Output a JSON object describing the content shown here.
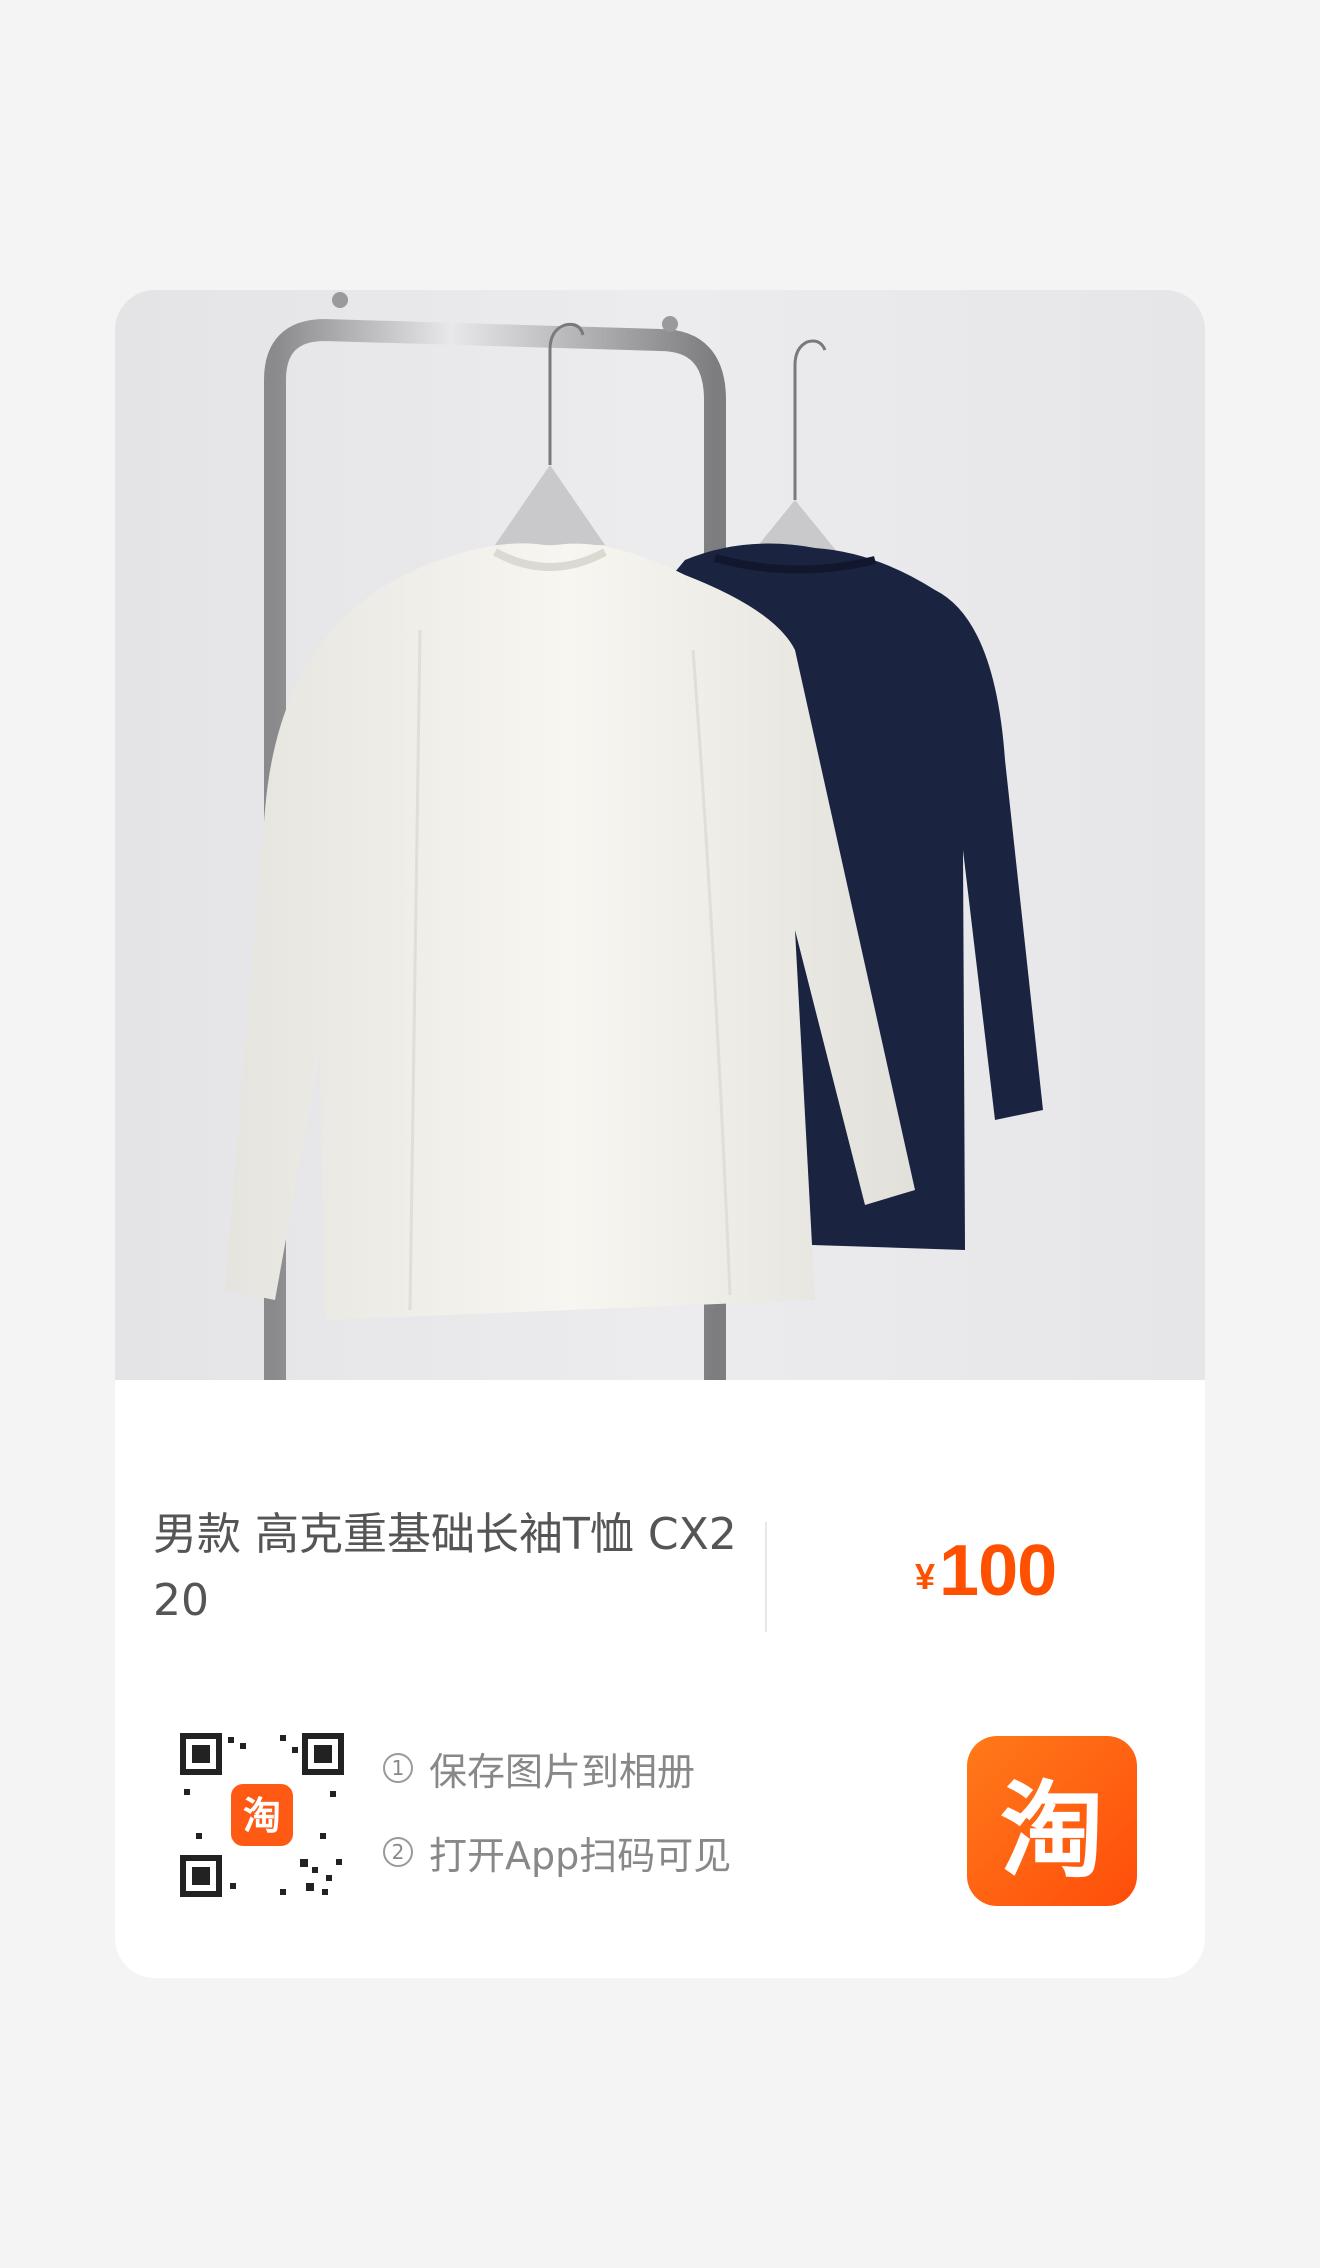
{
  "product": {
    "title": "男款 高克重基础长袖T恤 CX220",
    "price_symbol": "¥",
    "price_value": "100",
    "price_color": "#ff5000"
  },
  "instructions": [
    {
      "number": "1",
      "text": "保存图片到相册"
    },
    {
      "number": "2",
      "text": "打开App扫码可见"
    }
  ],
  "qr_badge": {
    "glyph": "淘"
  },
  "app_logo": {
    "glyph": "淘",
    "color": "#ff5000"
  }
}
